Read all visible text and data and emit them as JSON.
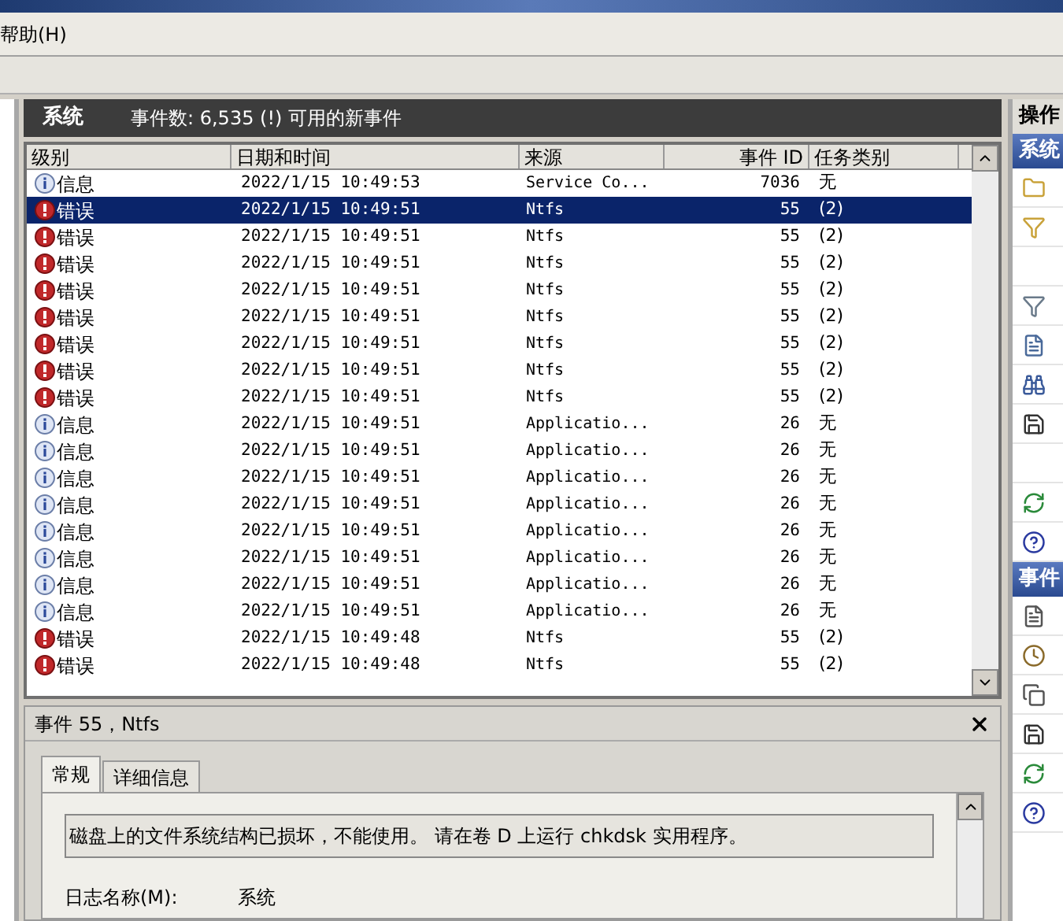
{
  "menu": {
    "items": [
      "帮助(H)"
    ]
  },
  "log_header": {
    "title": "系统",
    "summary": "事件数: 6,535 (!) 可用的新事件"
  },
  "table": {
    "columns": [
      "级别",
      "日期和时间",
      "来源",
      "事件 ID",
      "任务类别"
    ],
    "rows": [
      {
        "kind": "info",
        "severity": "信息",
        "datetime": "2022/1/15 10:49:53",
        "source": "Service Co...",
        "event_id": "7036",
        "category": "无",
        "selected": false
      },
      {
        "kind": "error",
        "severity": "错误",
        "datetime": "2022/1/15 10:49:51",
        "source": "Ntfs",
        "event_id": "55",
        "category": "(2)",
        "selected": true
      },
      {
        "kind": "error",
        "severity": "错误",
        "datetime": "2022/1/15 10:49:51",
        "source": "Ntfs",
        "event_id": "55",
        "category": "(2)",
        "selected": false
      },
      {
        "kind": "error",
        "severity": "错误",
        "datetime": "2022/1/15 10:49:51",
        "source": "Ntfs",
        "event_id": "55",
        "category": "(2)",
        "selected": false
      },
      {
        "kind": "error",
        "severity": "错误",
        "datetime": "2022/1/15 10:49:51",
        "source": "Ntfs",
        "event_id": "55",
        "category": "(2)",
        "selected": false
      },
      {
        "kind": "error",
        "severity": "错误",
        "datetime": "2022/1/15 10:49:51",
        "source": "Ntfs",
        "event_id": "55",
        "category": "(2)",
        "selected": false
      },
      {
        "kind": "error",
        "severity": "错误",
        "datetime": "2022/1/15 10:49:51",
        "source": "Ntfs",
        "event_id": "55",
        "category": "(2)",
        "selected": false
      },
      {
        "kind": "error",
        "severity": "错误",
        "datetime": "2022/1/15 10:49:51",
        "source": "Ntfs",
        "event_id": "55",
        "category": "(2)",
        "selected": false
      },
      {
        "kind": "error",
        "severity": "错误",
        "datetime": "2022/1/15 10:49:51",
        "source": "Ntfs",
        "event_id": "55",
        "category": "(2)",
        "selected": false
      },
      {
        "kind": "info",
        "severity": "信息",
        "datetime": "2022/1/15 10:49:51",
        "source": "Applicatio...",
        "event_id": "26",
        "category": "无",
        "selected": false
      },
      {
        "kind": "info",
        "severity": "信息",
        "datetime": "2022/1/15 10:49:51",
        "source": "Applicatio...",
        "event_id": "26",
        "category": "无",
        "selected": false
      },
      {
        "kind": "info",
        "severity": "信息",
        "datetime": "2022/1/15 10:49:51",
        "source": "Applicatio...",
        "event_id": "26",
        "category": "无",
        "selected": false
      },
      {
        "kind": "info",
        "severity": "信息",
        "datetime": "2022/1/15 10:49:51",
        "source": "Applicatio...",
        "event_id": "26",
        "category": "无",
        "selected": false
      },
      {
        "kind": "info",
        "severity": "信息",
        "datetime": "2022/1/15 10:49:51",
        "source": "Applicatio...",
        "event_id": "26",
        "category": "无",
        "selected": false
      },
      {
        "kind": "info",
        "severity": "信息",
        "datetime": "2022/1/15 10:49:51",
        "source": "Applicatio...",
        "event_id": "26",
        "category": "无",
        "selected": false
      },
      {
        "kind": "info",
        "severity": "信息",
        "datetime": "2022/1/15 10:49:51",
        "source": "Applicatio...",
        "event_id": "26",
        "category": "无",
        "selected": false
      },
      {
        "kind": "info",
        "severity": "信息",
        "datetime": "2022/1/15 10:49:51",
        "source": "Applicatio...",
        "event_id": "26",
        "category": "无",
        "selected": false
      },
      {
        "kind": "error",
        "severity": "错误",
        "datetime": "2022/1/15 10:49:48",
        "source": "Ntfs",
        "event_id": "55",
        "category": "(2)",
        "selected": false
      },
      {
        "kind": "error",
        "severity": "错误",
        "datetime": "2022/1/15 10:49:48",
        "source": "Ntfs",
        "event_id": "55",
        "category": "(2)",
        "selected": false
      }
    ]
  },
  "detail": {
    "title": "事件 55，Ntfs",
    "tabs": [
      {
        "label": "常规",
        "selected": true
      },
      {
        "label": "详细信息",
        "selected": false
      }
    ],
    "message": "磁盘上的文件系统结构已损坏，不能使用。 请在卷 D 上运行 chkdsk 实用程序。",
    "fields": [
      {
        "label": "日志名称(M):",
        "value": "系统"
      }
    ]
  },
  "actions": {
    "title": "操作",
    "sections": [
      "系统",
      "事件"
    ]
  }
}
